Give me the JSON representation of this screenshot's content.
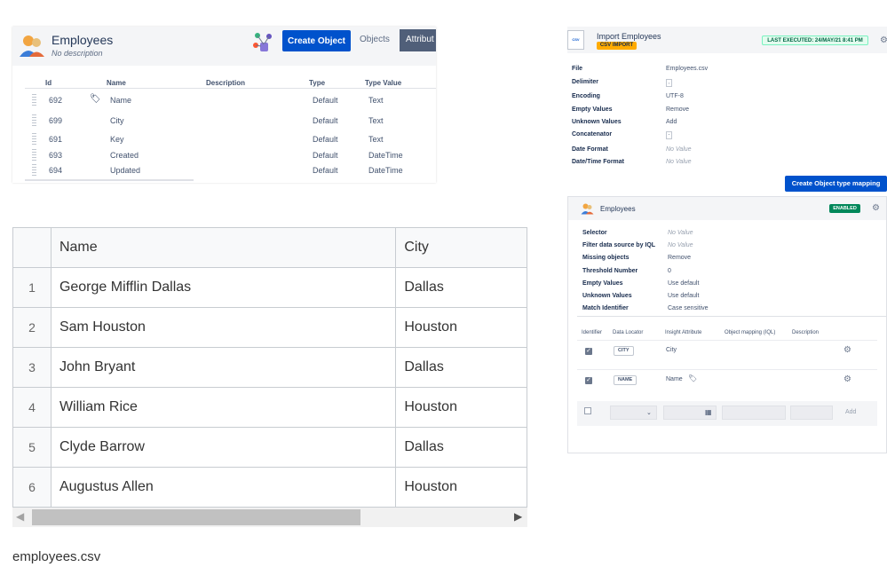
{
  "object_panel": {
    "title": "Employees",
    "subtitle": "No description",
    "create_button": "Create Object",
    "tab_objects": "Objects",
    "tab_attributes": "Attribut",
    "columns": [
      "Id",
      "Name",
      "Description",
      "Type",
      "Type Value"
    ],
    "rows": [
      {
        "id": "692",
        "name": "Name",
        "type": "Default",
        "type_value": "Text",
        "label_icon": true
      },
      {
        "id": "699",
        "name": "City",
        "type": "Default",
        "type_value": "Text",
        "label_icon": false
      },
      {
        "id": "691",
        "name": "Key",
        "type": "Default",
        "type_value": "Text",
        "label_icon": false
      },
      {
        "id": "693",
        "name": "Created",
        "type": "Default",
        "type_value": "DateTime",
        "label_icon": false
      },
      {
        "id": "694",
        "name": "Updated",
        "type": "Default",
        "type_value": "DateTime",
        "label_icon": false
      }
    ]
  },
  "csv_table": {
    "headers": [
      "",
      "Name",
      "City"
    ],
    "rows": [
      {
        "num": "1",
        "name": "George Mifflin Dallas",
        "city": "Dallas"
      },
      {
        "num": "2",
        "name": "Sam Houston",
        "city": "Houston"
      },
      {
        "num": "3",
        "name": "John Bryant",
        "city": "Dallas"
      },
      {
        "num": "4",
        "name": "William Rice",
        "city": "Houston"
      },
      {
        "num": "5",
        "name": "Clyde Barrow",
        "city": "Dallas"
      },
      {
        "num": "6",
        "name": "Augustus Allen",
        "city": "Houston"
      }
    ],
    "caption": "employees.csv"
  },
  "import_panel": {
    "title": "Import Employees",
    "type_badge": "CSV IMPORT",
    "file_icon_text": "CSV",
    "last_executed": "LAST EXECUTED: 24/MAY/21 8:41 PM",
    "fields": [
      {
        "key": "File",
        "value": "Employees.csv"
      },
      {
        "key": "Delimiter",
        "value": ","
      },
      {
        "key": "Encoding",
        "value": "UTF-8"
      },
      {
        "key": "Empty Values",
        "value": "Remove"
      },
      {
        "key": "Unknown Values",
        "value": "Add"
      },
      {
        "key": "Concatenator",
        "value": "-"
      },
      {
        "key": "Date Format",
        "value": "No Value"
      },
      {
        "key": "Date/Time Format",
        "value": "No Value"
      }
    ],
    "mapping_button": "Create Object type mapping"
  },
  "mapping_panel": {
    "title": "Employees",
    "status_badge": "ENABLED",
    "fields": [
      {
        "key": "Selector",
        "value": "No Value"
      },
      {
        "key": "Filter data source by IQL",
        "value": "No Value"
      },
      {
        "key": "Missing objects",
        "value": "Remove"
      },
      {
        "key": "Threshold Number",
        "value": "0"
      },
      {
        "key": "Empty Values",
        "value": "Use default"
      },
      {
        "key": "Unknown Values",
        "value": "Use default"
      },
      {
        "key": "Match Identifier",
        "value": "Case sensitive"
      }
    ],
    "columns": [
      "Identifier",
      "Data Locator",
      "Insight Attribute",
      "Object mapping (IQL)",
      "Description"
    ],
    "rows": [
      {
        "locator": "CITY",
        "attribute": "City"
      },
      {
        "locator": "NAME",
        "attribute": "Name"
      }
    ],
    "add_button": "Add"
  }
}
